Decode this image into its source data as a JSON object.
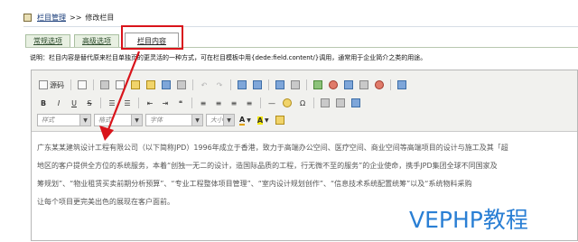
{
  "breadcrumb": {
    "section": "栏目管理",
    "separator": ">>",
    "current": "修改栏目"
  },
  "tabs": [
    {
      "label": "常规选项"
    },
    {
      "label": "高级选项"
    },
    {
      "label": "栏目内容"
    }
  ],
  "description": "说明：栏目内容是替代原来栏目单独页的更灵活的一种方式，可在栏目模板中用{dede:field.content/}调用，通常用于企业简介之类的用途。",
  "toolbar": {
    "source_label": "源码",
    "style_placeholder": "样式",
    "format_placeholder": "格式",
    "font_placeholder": "字体",
    "size_placeholder": "大小"
  },
  "editor_content": [
    "广东某某建筑设计工程有限公司（以下简称JPD）1996年成立于香港，致力于高端办公空间、医疗空间、商业空间等高端项目的设计与施工及其「超",
    "地区的客户提供全方位的系统服务，本着“创独一无二的设计，造国际品质的工程，行无微不至的服务”的企业使命，携手JPD集团全球不同国家及",
    "筹规划”、“物业租赁买卖前期分析预算”、“专业工程整体项目管理”、“室内设计规划创作”、“信息技术系统配置统筹”以及“系统物料采购",
    "让每个项目更完美出色的展现在客户面前。"
  ],
  "watermark": "VEPHP教程",
  "colors": {
    "highlight_box": "#d9141b",
    "watermark": "#2a7fd4"
  }
}
